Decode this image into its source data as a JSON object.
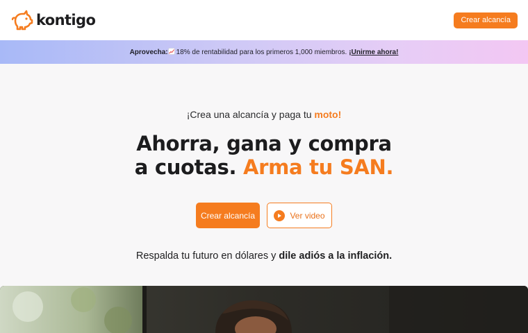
{
  "header": {
    "brand": "kontigo",
    "cta_label": "Crear alcancía"
  },
  "promo": {
    "lead": "Aprovecha:",
    "icon": "chart-increasing-icon",
    "text": " 18% de rentabilidad para los primeros 1,000 miembros. ",
    "link": "¡Unirme ahora!"
  },
  "hero": {
    "eyebrow_text": "¡Crea una alcancía y paga tu ",
    "eyebrow_accent": "moto!",
    "headline_line1": "Ahorra, gana y compra",
    "headline_line2_plain": "a cuotas. ",
    "headline_line2_accent": "Arma tu SAN.",
    "primary_cta": "Crear alcancía",
    "secondary_cta": "Ver video",
    "subline_plain": "Respalda tu futuro en dólares y ",
    "subline_bold": "dile adiós a la inflación."
  },
  "colors": {
    "accent": "#f57c1f",
    "text": "#1f1f21",
    "background": "#f8f7f8"
  }
}
